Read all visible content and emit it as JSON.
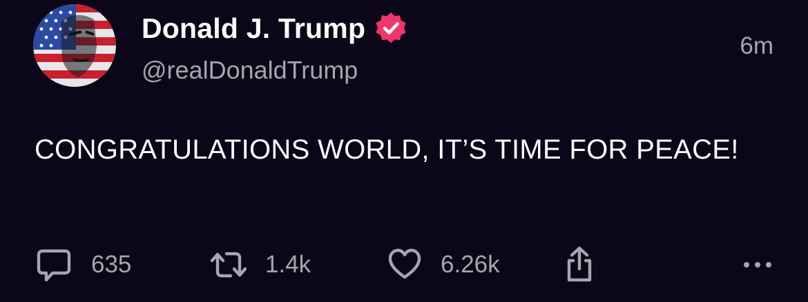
{
  "post": {
    "author": {
      "display_name": "Donald J. Trump",
      "handle": "@realDonaldTrump",
      "verified": true,
      "verified_color": "#f0356a"
    },
    "time_ago": "6m",
    "text": "CONGRATULATIONS WORLD, IT’S TIME FOR PEACE!",
    "stats": {
      "replies": "635",
      "reposts": "1.4k",
      "likes": "6.26k"
    }
  },
  "icons": {
    "reply": "speech-bubble-icon",
    "repost": "repost-arrows-icon",
    "like": "heart-icon",
    "share": "share-upload-icon",
    "more": "ellipsis-icon"
  },
  "colors": {
    "background": "#0b0718",
    "primary_text": "#ffffff",
    "secondary_text": "#a7a5ad"
  }
}
